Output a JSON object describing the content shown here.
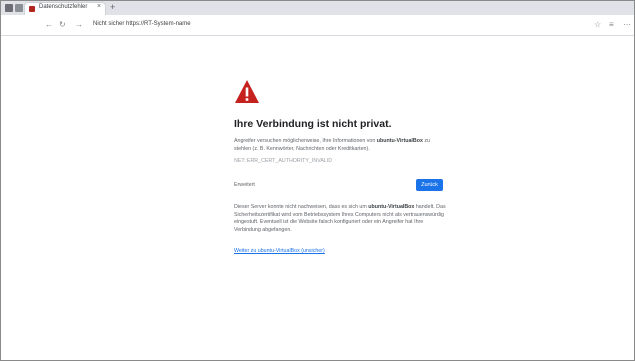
{
  "tab": {
    "title": "Datenschutzfehler",
    "close": "×",
    "new_tab": "+"
  },
  "toolbar": {
    "back": "←",
    "forward": "→",
    "reload": "↻",
    "url": "Nicht sicher  https://RT-System-name"
  },
  "error": {
    "heading": "Ihre Verbindung ist nicht privat.",
    "paragraph_prefix": "Angreifer versuchen möglicherweise, Ihre Informationen von ",
    "host": "ubuntu-VirtualBox",
    "paragraph_suffix": " zu stehlen (z. B. Kennwörter, Nachrichten oder Kreditkarten).",
    "error_code": "NET::ERR_CERT_AUTHORITY_INVALID",
    "advanced_label": "Erweitert",
    "back_label": "Zurück",
    "details_prefix": "Dieser Server konnte nicht nachweisen, dass es sich um ",
    "details_host": "ubuntu-VirtualBox",
    "details_suffix": " handelt. Das Sicherheitszertifikat wird vom Betriebssystem Ihres Computers nicht als vertrauenswürdig eingestuft. Eventuell ist die Website falsch konfiguriert oder ein Angreifer hat Ihre Verbindung abgefangen.",
    "proceed_link": "Weiter zu ubuntu-VirtualBox (unsicher)"
  },
  "colors": {
    "warning": "#c5221f",
    "primary": "#1a73e8"
  }
}
